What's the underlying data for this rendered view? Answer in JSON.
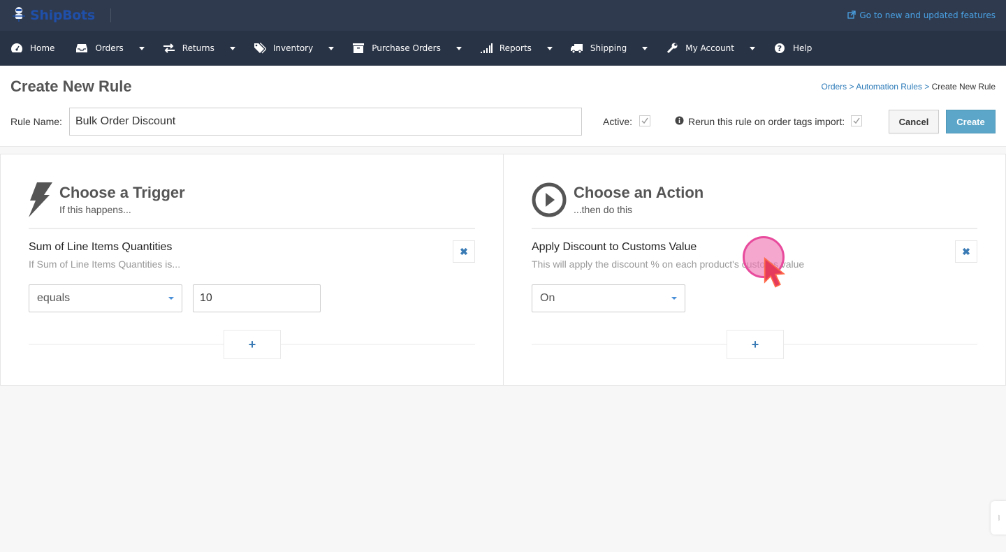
{
  "app": {
    "brand": "ShipBots",
    "external_link": "Go to new and updated features"
  },
  "nav": [
    {
      "label": "Home",
      "icon": "dashboard-icon",
      "has_dropdown": false
    },
    {
      "label": "Orders",
      "icon": "inbox-icon",
      "has_dropdown": true
    },
    {
      "label": "Returns",
      "icon": "exchange-icon",
      "has_dropdown": true
    },
    {
      "label": "Inventory",
      "icon": "tags-icon",
      "has_dropdown": true
    },
    {
      "label": "Purchase Orders",
      "icon": "archive-box-icon",
      "has_dropdown": true
    },
    {
      "label": "Reports",
      "icon": "signal-bars-icon",
      "has_dropdown": true
    },
    {
      "label": "Shipping",
      "icon": "truck-icon",
      "has_dropdown": true
    },
    {
      "label": "My Account",
      "icon": "wrench-icon",
      "has_dropdown": true
    },
    {
      "label": "Help",
      "icon": "question-circle-icon",
      "has_dropdown": false
    }
  ],
  "page": {
    "title": "Create New Rule",
    "breadcrumb": {
      "items": [
        "Orders",
        "Automation Rules"
      ],
      "separator": ">",
      "current": "Create New Rule"
    },
    "rule_name_label": "Rule Name:",
    "rule_name_value": "Bulk Order Discount",
    "active_label": "Active:",
    "active_checked": true,
    "rerun_label": "Rerun this rule on order tags import:",
    "rerun_checked": true,
    "cancel_label": "Cancel",
    "create_label": "Create"
  },
  "trigger": {
    "title": "Choose a Trigger",
    "subtitle": "If this happens...",
    "item_title": "Sum of Line Items Quantities",
    "item_subtitle": "If Sum of Line Items Quantities is...",
    "operator": "equals",
    "value": "10",
    "add_label": "+"
  },
  "action": {
    "title": "Choose an Action",
    "subtitle": "...then do this",
    "item_title": "Apply Discount to Customs Value",
    "item_subtitle": "This will apply the discount % on each product's customs value",
    "value": "On",
    "add_label": "+"
  },
  "colors": {
    "topbar": "#2f3a4e",
    "navbar": "#283345",
    "link": "#2b7ab8",
    "create_button": "#5ba6c9"
  }
}
